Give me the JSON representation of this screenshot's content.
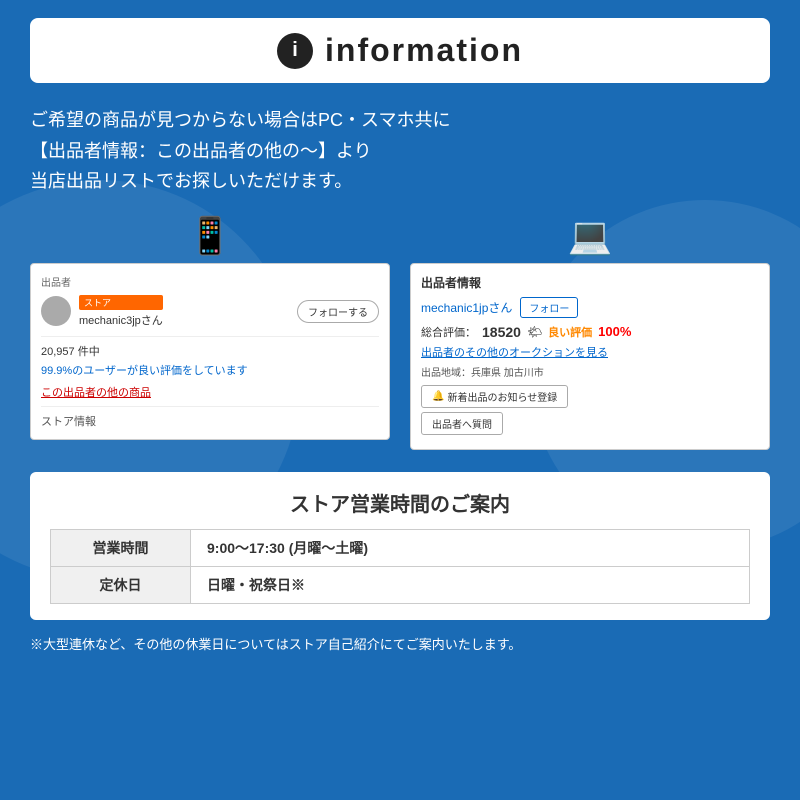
{
  "header": {
    "icon_label": "i",
    "title": "information"
  },
  "intro": {
    "line1": "ご希望の商品が見つからない場合はPC・スマホ共に",
    "line2": "【出品者情報：この出品者の他の〜】より",
    "line3": "当店出品リストでお探しいただけます。"
  },
  "mobile_screenshot": {
    "section_label": "出品者",
    "store_badge": "ストア",
    "seller_name": "mechanic3jpさん",
    "follow_btn": "フォローする",
    "count_text": "20,957 件中",
    "rating_text": "99.9%のユーザーが良い評価をしています",
    "other_items_link": "この出品者の他の商品",
    "store_info_link": "ストア情報"
  },
  "pc_screenshot": {
    "section_label": "出品者情報",
    "seller_name": "mechanic1jpさん",
    "follow_btn": "フォロー",
    "eval_label": "総合評価：",
    "eval_num": "18520",
    "good_label": "良い評価",
    "good_pct": "100%",
    "auction_link": "出品者のその他のオークションを見る",
    "location": "出品地域：兵庫県 加古川市",
    "notification_btn": "新着出品のお知らせ登録",
    "question_btn": "出品者へ質問"
  },
  "store_hours": {
    "title": "ストア営業時間のご案内",
    "rows": [
      {
        "label": "営業時間",
        "value": "9:00〜17:30 (月曜〜土曜)"
      },
      {
        "label": "定休日",
        "value": "日曜・祝祭日※"
      }
    ]
  },
  "footer_note": "※大型連休など、その他の休業日についてはストア自己紹介にてご案内いたします。"
}
